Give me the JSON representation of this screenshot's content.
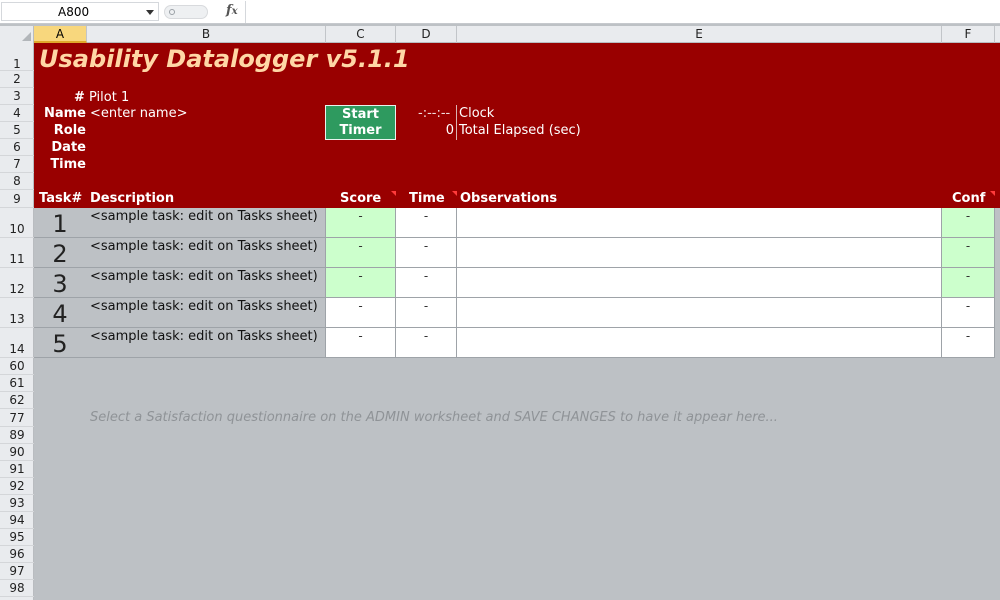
{
  "formula_bar": {
    "name_box": "A800",
    "fx": "fx",
    "formula": ""
  },
  "columns": [
    "A",
    "B",
    "C",
    "D",
    "E",
    "F"
  ],
  "rows": [
    "1",
    "2",
    "3",
    "4",
    "5",
    "6",
    "7",
    "8",
    "9",
    "10",
    "11",
    "12",
    "13",
    "14",
    "60",
    "61",
    "62",
    "77",
    "89",
    "90",
    "91",
    "92",
    "93",
    "94",
    "95",
    "96",
    "97",
    "98"
  ],
  "header": {
    "title": "Usability Datalogger v5.1.1",
    "hash": "#",
    "participant": "Pilot 1",
    "name_label": "Name",
    "name_value": "<enter name>",
    "role_label": "Role",
    "date_label": "Date",
    "time_label": "Time",
    "timer_button_line1": "Start",
    "timer_button_line2": "Timer",
    "clock_value": "-:--:--",
    "clock_label": "Clock",
    "elapsed_value": "0",
    "elapsed_label": "Total Elapsed (sec)"
  },
  "table": {
    "headers": {
      "task": "Task#",
      "description": "Description",
      "score": "Score",
      "time": "Time",
      "observations": "Observations",
      "conf": "Conf"
    },
    "rows": [
      {
        "num": "1",
        "desc": "<sample task: edit on Tasks sheet)",
        "score": "-",
        "time": "-",
        "conf": "-",
        "highlight": true
      },
      {
        "num": "2",
        "desc": "<sample task: edit on Tasks sheet)",
        "score": "-",
        "time": "-",
        "conf": "-",
        "highlight": true
      },
      {
        "num": "3",
        "desc": "<sample task: edit on Tasks sheet)",
        "score": "-",
        "time": "-",
        "conf": "-",
        "highlight": true
      },
      {
        "num": "4",
        "desc": "<sample task: edit on Tasks sheet)",
        "score": "-",
        "time": "-",
        "conf": "-",
        "highlight": false
      },
      {
        "num": "5",
        "desc": "<sample task: edit on Tasks sheet)",
        "score": "-",
        "time": "-",
        "conf": "-",
        "highlight": false
      }
    ]
  },
  "satisfaction_message": "Select a Satisfaction questionnaire on the ADMIN worksheet and SAVE CHANGES to have it appear here...",
  "colors": {
    "band": "#990000",
    "title": "#ffd7a6",
    "button": "#2e9a5f",
    "highlight": "#ccffcc",
    "sheet_bg": "#bdc1c5"
  }
}
